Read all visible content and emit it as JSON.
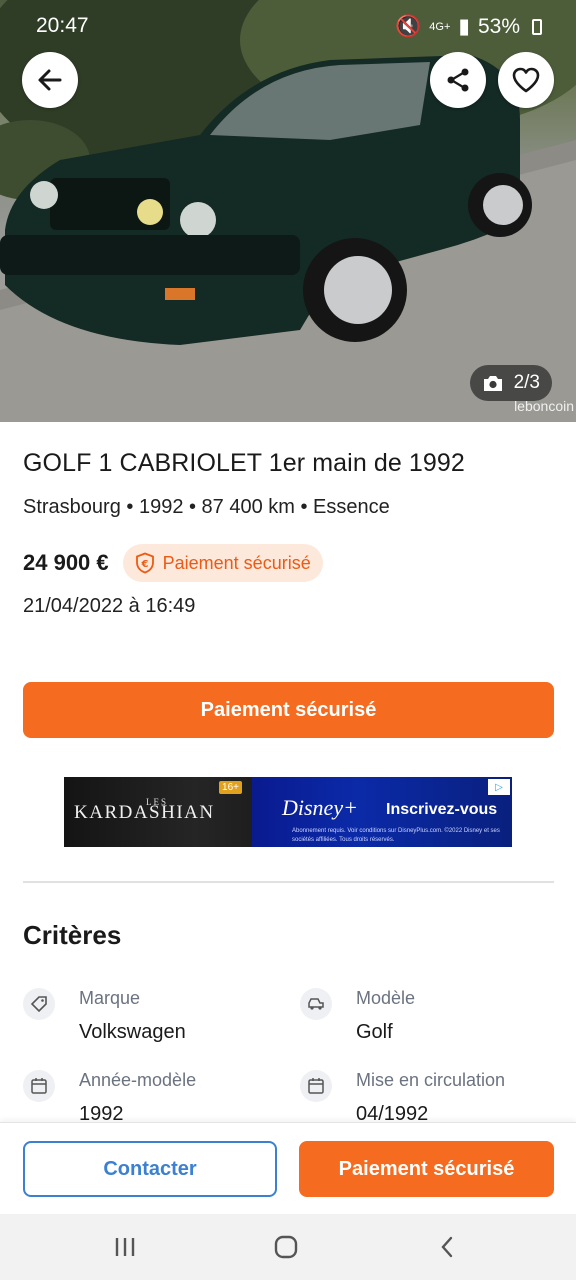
{
  "status_bar": {
    "time": "20:47",
    "network": "4G+",
    "battery": "53%"
  },
  "hero": {
    "photo_counter": "2/3",
    "watermark": "leboncoin",
    "icons": [
      "back-arrow-icon",
      "share-icon",
      "heart-icon",
      "camera-icon"
    ]
  },
  "listing": {
    "title": "GOLF 1 CABRIOLET 1er main de 1992",
    "subtitle": "Strasbourg • 1992 • 87 400 km • Essence",
    "price": "24 900 €",
    "secure_badge": "Paiement sécurisé",
    "date": "21/04/2022 à 16:49"
  },
  "primary_cta": "Paiement sécurisé",
  "ad": {
    "left_small": "LES",
    "left_brand": "KARDASHIAN",
    "age_rating": "16+",
    "disney": "Disney+",
    "cta": "Inscrivez-vous",
    "fine_print": "Abonnement requis. Voir conditions sur DisneyPlus.com. ©2022 Disney et ses sociétés affiliées. Tous droits réservés."
  },
  "criteria": {
    "title": "Critères",
    "items": [
      {
        "label": "Marque",
        "value": "Volkswagen",
        "icon": "tag-icon"
      },
      {
        "label": "Modèle",
        "value": "Golf",
        "icon": "car-icon"
      },
      {
        "label": "Année-modèle",
        "value": "1992",
        "icon": "calendar-icon"
      },
      {
        "label": "Mise en circulation",
        "value": "04/1992",
        "icon": "calendar-icon"
      }
    ]
  },
  "bottom_bar": {
    "contact": "Contacter",
    "pay": "Paiement sécurisé"
  },
  "colors": {
    "accent": "#f56b1f",
    "link_blue": "#3c80d1",
    "pill_bg": "#fde8dc"
  }
}
